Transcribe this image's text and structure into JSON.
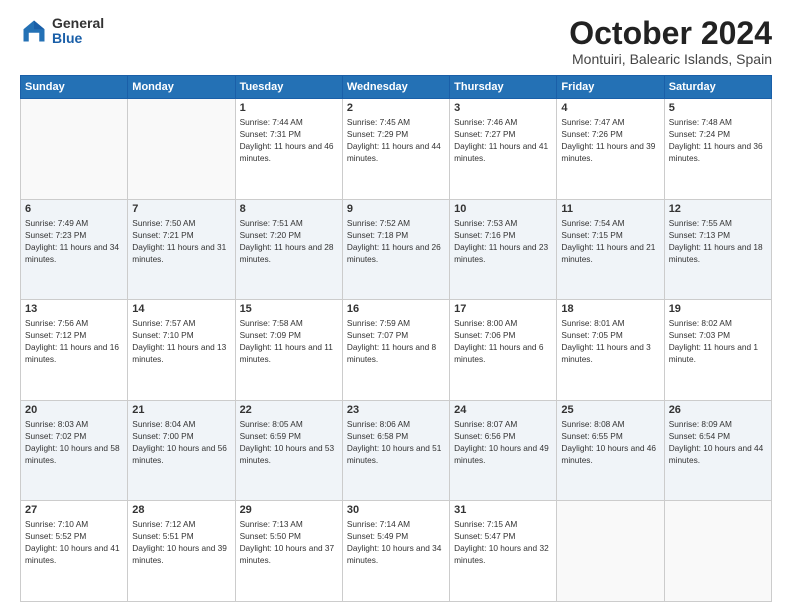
{
  "header": {
    "logo_general": "General",
    "logo_blue": "Blue",
    "month_title": "October 2024",
    "location": "Montuiri, Balearic Islands, Spain"
  },
  "days_of_week": [
    "Sunday",
    "Monday",
    "Tuesday",
    "Wednesday",
    "Thursday",
    "Friday",
    "Saturday"
  ],
  "weeks": [
    [
      {
        "day": "",
        "info": ""
      },
      {
        "day": "",
        "info": ""
      },
      {
        "day": "1",
        "info": "Sunrise: 7:44 AM\nSunset: 7:31 PM\nDaylight: 11 hours and 46 minutes."
      },
      {
        "day": "2",
        "info": "Sunrise: 7:45 AM\nSunset: 7:29 PM\nDaylight: 11 hours and 44 minutes."
      },
      {
        "day": "3",
        "info": "Sunrise: 7:46 AM\nSunset: 7:27 PM\nDaylight: 11 hours and 41 minutes."
      },
      {
        "day": "4",
        "info": "Sunrise: 7:47 AM\nSunset: 7:26 PM\nDaylight: 11 hours and 39 minutes."
      },
      {
        "day": "5",
        "info": "Sunrise: 7:48 AM\nSunset: 7:24 PM\nDaylight: 11 hours and 36 minutes."
      }
    ],
    [
      {
        "day": "6",
        "info": "Sunrise: 7:49 AM\nSunset: 7:23 PM\nDaylight: 11 hours and 34 minutes."
      },
      {
        "day": "7",
        "info": "Sunrise: 7:50 AM\nSunset: 7:21 PM\nDaylight: 11 hours and 31 minutes."
      },
      {
        "day": "8",
        "info": "Sunrise: 7:51 AM\nSunset: 7:20 PM\nDaylight: 11 hours and 28 minutes."
      },
      {
        "day": "9",
        "info": "Sunrise: 7:52 AM\nSunset: 7:18 PM\nDaylight: 11 hours and 26 minutes."
      },
      {
        "day": "10",
        "info": "Sunrise: 7:53 AM\nSunset: 7:16 PM\nDaylight: 11 hours and 23 minutes."
      },
      {
        "day": "11",
        "info": "Sunrise: 7:54 AM\nSunset: 7:15 PM\nDaylight: 11 hours and 21 minutes."
      },
      {
        "day": "12",
        "info": "Sunrise: 7:55 AM\nSunset: 7:13 PM\nDaylight: 11 hours and 18 minutes."
      }
    ],
    [
      {
        "day": "13",
        "info": "Sunrise: 7:56 AM\nSunset: 7:12 PM\nDaylight: 11 hours and 16 minutes."
      },
      {
        "day": "14",
        "info": "Sunrise: 7:57 AM\nSunset: 7:10 PM\nDaylight: 11 hours and 13 minutes."
      },
      {
        "day": "15",
        "info": "Sunrise: 7:58 AM\nSunset: 7:09 PM\nDaylight: 11 hours and 11 minutes."
      },
      {
        "day": "16",
        "info": "Sunrise: 7:59 AM\nSunset: 7:07 PM\nDaylight: 11 hours and 8 minutes."
      },
      {
        "day": "17",
        "info": "Sunrise: 8:00 AM\nSunset: 7:06 PM\nDaylight: 11 hours and 6 minutes."
      },
      {
        "day": "18",
        "info": "Sunrise: 8:01 AM\nSunset: 7:05 PM\nDaylight: 11 hours and 3 minutes."
      },
      {
        "day": "19",
        "info": "Sunrise: 8:02 AM\nSunset: 7:03 PM\nDaylight: 11 hours and 1 minute."
      }
    ],
    [
      {
        "day": "20",
        "info": "Sunrise: 8:03 AM\nSunset: 7:02 PM\nDaylight: 10 hours and 58 minutes."
      },
      {
        "day": "21",
        "info": "Sunrise: 8:04 AM\nSunset: 7:00 PM\nDaylight: 10 hours and 56 minutes."
      },
      {
        "day": "22",
        "info": "Sunrise: 8:05 AM\nSunset: 6:59 PM\nDaylight: 10 hours and 53 minutes."
      },
      {
        "day": "23",
        "info": "Sunrise: 8:06 AM\nSunset: 6:58 PM\nDaylight: 10 hours and 51 minutes."
      },
      {
        "day": "24",
        "info": "Sunrise: 8:07 AM\nSunset: 6:56 PM\nDaylight: 10 hours and 49 minutes."
      },
      {
        "day": "25",
        "info": "Sunrise: 8:08 AM\nSunset: 6:55 PM\nDaylight: 10 hours and 46 minutes."
      },
      {
        "day": "26",
        "info": "Sunrise: 8:09 AM\nSunset: 6:54 PM\nDaylight: 10 hours and 44 minutes."
      }
    ],
    [
      {
        "day": "27",
        "info": "Sunrise: 7:10 AM\nSunset: 5:52 PM\nDaylight: 10 hours and 41 minutes."
      },
      {
        "day": "28",
        "info": "Sunrise: 7:12 AM\nSunset: 5:51 PM\nDaylight: 10 hours and 39 minutes."
      },
      {
        "day": "29",
        "info": "Sunrise: 7:13 AM\nSunset: 5:50 PM\nDaylight: 10 hours and 37 minutes."
      },
      {
        "day": "30",
        "info": "Sunrise: 7:14 AM\nSunset: 5:49 PM\nDaylight: 10 hours and 34 minutes."
      },
      {
        "day": "31",
        "info": "Sunrise: 7:15 AM\nSunset: 5:47 PM\nDaylight: 10 hours and 32 minutes."
      },
      {
        "day": "",
        "info": ""
      },
      {
        "day": "",
        "info": ""
      }
    ]
  ]
}
